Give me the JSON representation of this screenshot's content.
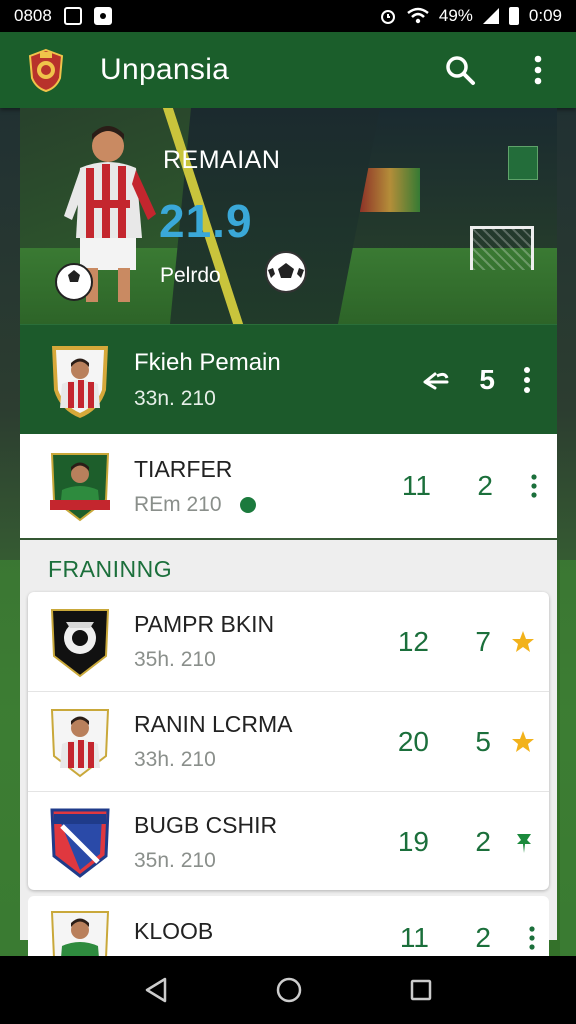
{
  "status_bar": {
    "time_left": "0808",
    "battery": "49%",
    "time_right": "0:09"
  },
  "app_bar": {
    "title": "Unpansia",
    "search_icon": "search-icon",
    "menu_icon": "more-vertical-icon"
  },
  "hero": {
    "title": "REMAIAN",
    "score": "21.9",
    "subtitle": "Pelrdo"
  },
  "featured": {
    "name": "Fkieh Pemain",
    "date": "33n. 210",
    "number": "5"
  },
  "list": [
    {
      "name": "TIARFER",
      "date": "REm 210",
      "a": "11",
      "b": "2"
    }
  ],
  "section": {
    "title": "FRANINNG",
    "items": [
      {
        "name": "PAMPR BKIN",
        "date": "35h. 210",
        "a": "12",
        "b": "7",
        "mark": "star"
      },
      {
        "name": "RANIN LCRMA",
        "date": "33h. 210",
        "a": "20",
        "b": "5",
        "mark": "star"
      },
      {
        "name": "BUGB CSHIR",
        "date": "35n. 210",
        "a": "19",
        "b": "2",
        "mark": "pin"
      },
      {
        "name": "KLOOB",
        "date": "",
        "a": "11",
        "b": "2",
        "mark": "more"
      }
    ]
  },
  "colors": {
    "primary": "#1b5e2b",
    "accent": "#1b6f3b",
    "star": "#f2b21b",
    "score": "#3aa8d8"
  }
}
